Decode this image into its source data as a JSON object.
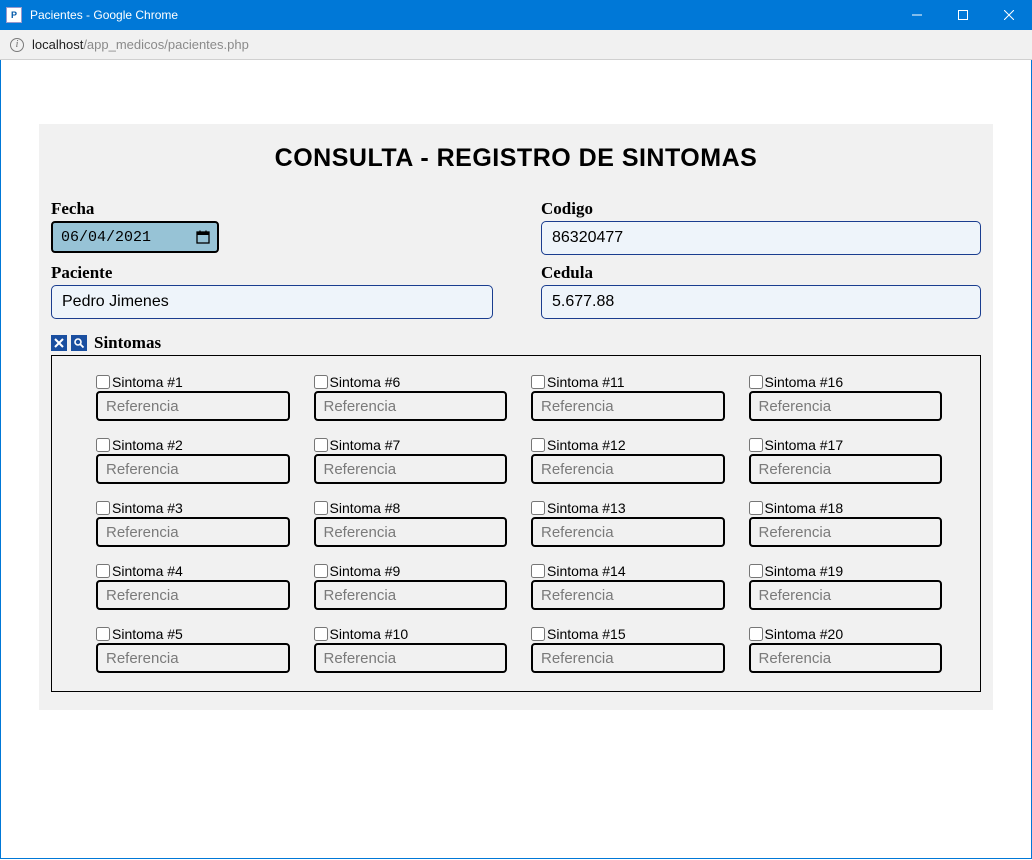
{
  "window": {
    "title": "Pacientes - Google Chrome",
    "url_host": "localhost",
    "url_path": "/app_medicos/pacientes.php"
  },
  "panel": {
    "title": "CONSULTA - REGISTRO DE SINTOMAS"
  },
  "fields": {
    "fecha": {
      "label": "Fecha",
      "value": "06/04/2021"
    },
    "codigo": {
      "label": "Codigo",
      "value": "86320477"
    },
    "paciente": {
      "label": "Paciente",
      "value": "Pedro Jimenes"
    },
    "cedula": {
      "label": "Cedula",
      "value": "5.677.88"
    }
  },
  "sintomas": {
    "title": "Sintomas",
    "ref_placeholder": "Referencia",
    "items": [
      {
        "label": "Sintoma #1"
      },
      {
        "label": "Sintoma #2"
      },
      {
        "label": "Sintoma #3"
      },
      {
        "label": "Sintoma #4"
      },
      {
        "label": "Sintoma #5"
      },
      {
        "label": "Sintoma #6"
      },
      {
        "label": "Sintoma #7"
      },
      {
        "label": "Sintoma #8"
      },
      {
        "label": "Sintoma #9"
      },
      {
        "label": "Sintoma #10"
      },
      {
        "label": "Sintoma #11"
      },
      {
        "label": "Sintoma #12"
      },
      {
        "label": "Sintoma #13"
      },
      {
        "label": "Sintoma #14"
      },
      {
        "label": "Sintoma #15"
      },
      {
        "label": "Sintoma #16"
      },
      {
        "label": "Sintoma #17"
      },
      {
        "label": "Sintoma #18"
      },
      {
        "label": "Sintoma #19"
      },
      {
        "label": "Sintoma #20"
      }
    ]
  }
}
